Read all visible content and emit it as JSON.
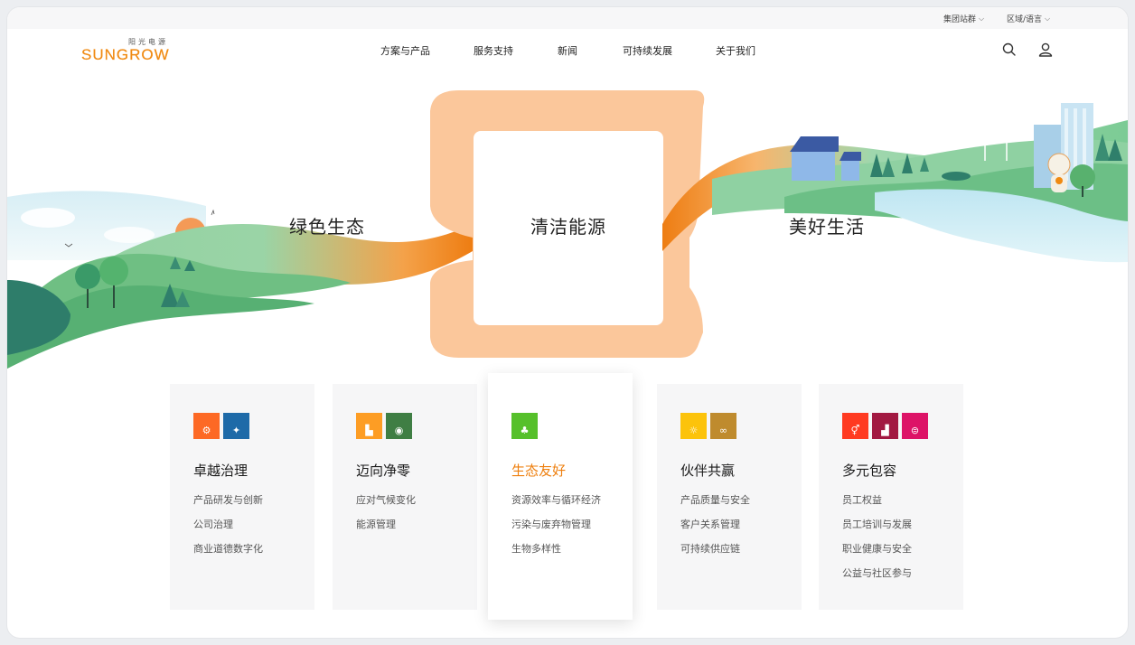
{
  "topbar": {
    "group_sites": "集团站群",
    "region_language": "区域/语言"
  },
  "brand": {
    "cn": "阳光电源",
    "en": "SUNGROW",
    "color": "#f08a12"
  },
  "nav": {
    "items": [
      "方案与产品",
      "服务支持",
      "新闻",
      "可持续发展",
      "关于我们"
    ]
  },
  "hero": {
    "left_label": "绿色生态",
    "center_label": "清洁能源",
    "right_label": "美好生活"
  },
  "cards": [
    {
      "title": "卓越治理",
      "sdgs": [
        {
          "num": "8",
          "color": "#c5192d"
        },
        {
          "num": "9",
          "color": "#fd6925"
        }
      ],
      "items": [
        "产品研发与创新",
        "公司治理",
        "商业道德数字化"
      ]
    },
    {
      "title": "迈向净零",
      "sdgs": [
        {
          "num": "11",
          "color": "#fd9d24"
        },
        {
          "num": "13",
          "color": "#3f7e44"
        }
      ],
      "items": [
        "应对气候变化",
        "能源管理"
      ]
    },
    {
      "title": "生态友好",
      "sdgs": [
        {
          "num": "15",
          "color": "#56c02b"
        }
      ],
      "items": [
        "资源效率与循环经济",
        "污染与废弃物管理",
        "生物多样性"
      ]
    },
    {
      "title": "伙伴共赢",
      "sdgs": [
        {
          "num": "7",
          "color": "#fcc30b"
        },
        {
          "num": "12",
          "color": "#bf8b2e"
        }
      ],
      "items": [
        "产品质量与安全",
        "客户关系管理",
        "可持续供应链"
      ]
    },
    {
      "title": "多元包容",
      "sdgs": [
        {
          "num": "5",
          "color": "#ff3a21"
        },
        {
          "num": "8",
          "color": "#a21942"
        },
        {
          "num": "10",
          "color": "#dd1367"
        }
      ],
      "items": [
        "员工权益",
        "员工培训与发展",
        "职业健康与安全",
        "公益与社区参与"
      ]
    }
  ]
}
